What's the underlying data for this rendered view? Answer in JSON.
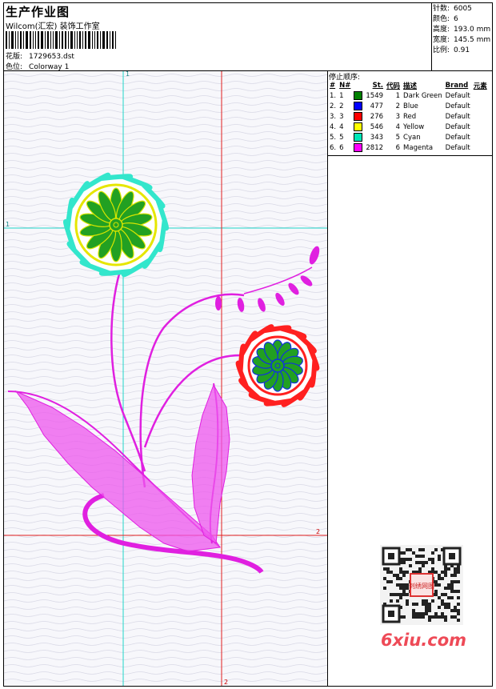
{
  "header": {
    "title": "生产作业图",
    "studio": "Wilcom(汇宏) 装饰工作室",
    "design_label": "花版:",
    "design_value": "1729653.dst",
    "colorway_label": "色位:",
    "colorway_value": "Colorway 1"
  },
  "stats": {
    "stitches_label": "针数:",
    "stitches_value": "6005",
    "colors_label": "颜色:",
    "colors_value": "6",
    "height_label": "高度:",
    "height_value": "193.0 mm",
    "width_label": "宽度:",
    "width_value": "145.5 mm",
    "scale_label": "比例:",
    "scale_value": "0.91"
  },
  "sequence": {
    "title": "停止顺序:",
    "headers": [
      "#",
      "N#",
      "St.",
      "代码",
      "描述",
      "Brand",
      "元素"
    ],
    "rows": [
      {
        "idx": "1.",
        "n": "1",
        "st": "1549",
        "code": "1",
        "desc": "Dark Green",
        "brand": "Default",
        "color": "#008000"
      },
      {
        "idx": "2.",
        "n": "2",
        "st": "477",
        "code": "2",
        "desc": "Blue",
        "brand": "Default",
        "color": "#0000ff"
      },
      {
        "idx": "3.",
        "n": "3",
        "st": "276",
        "code": "3",
        "desc": "Red",
        "brand": "Default",
        "color": "#ff0000"
      },
      {
        "idx": "4.",
        "n": "4",
        "st": "546",
        "code": "4",
        "desc": "Yellow",
        "brand": "Default",
        "color": "#ffff00"
      },
      {
        "idx": "5.",
        "n": "5",
        "st": "343",
        "code": "5",
        "desc": "Cyan",
        "brand": "Default",
        "color": "#00e6b8"
      },
      {
        "idx": "6.",
        "n": "6",
        "st": "2812",
        "code": "6",
        "desc": "Magenta",
        "brand": "Default",
        "color": "#ff00ff"
      }
    ]
  },
  "guides": {
    "v1": "1",
    "h1": "1",
    "h2": "2",
    "v2": "2"
  },
  "watermark": {
    "text": "6xiu.com",
    "stamp": "刺绣网图"
  }
}
